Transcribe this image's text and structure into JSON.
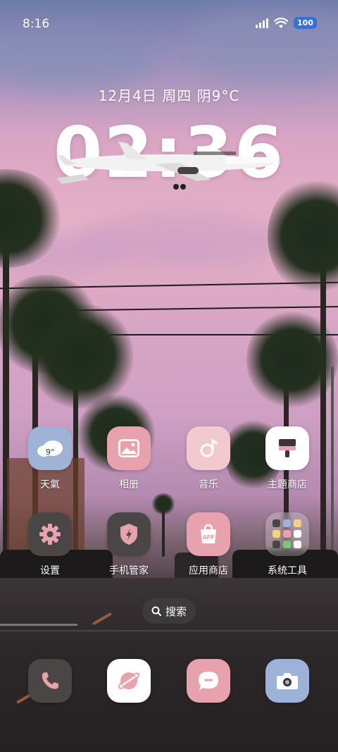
{
  "status_bar": {
    "time": "8:16",
    "battery": "100"
  },
  "lockscreen": {
    "date_line": "12月4日 周四 阴9°C",
    "clock": "02:36"
  },
  "weather_widget": {
    "temp": "9°"
  },
  "apps_row1": [
    {
      "label": "天氣",
      "icon": "weather-icon"
    },
    {
      "label": "相册",
      "icon": "gallery-icon"
    },
    {
      "label": "音乐",
      "icon": "music-icon"
    },
    {
      "label": "主題商店",
      "icon": "theme-store-icon"
    }
  ],
  "apps_row2": [
    {
      "label": "设置",
      "icon": "gear-icon"
    },
    {
      "label": "手机管家",
      "icon": "shield-icon"
    },
    {
      "label": "应用商店",
      "icon": "app-store-icon"
    },
    {
      "label": "系统工具",
      "icon": "folder-icon"
    }
  ],
  "app_store_badge": "APP",
  "search": {
    "label": "搜索"
  },
  "dock": [
    {
      "icon": "phone-icon"
    },
    {
      "icon": "browser-icon"
    },
    {
      "icon": "messages-icon"
    },
    {
      "icon": "camera-icon"
    }
  ],
  "colors": {
    "pink": "#e8a2ad",
    "light_pink": "#f2c9cf",
    "dark_gray": "#4a4646",
    "weather_blue": "#9fb3d6",
    "camera_blue": "#9db2d8",
    "white": "#ffffff"
  }
}
